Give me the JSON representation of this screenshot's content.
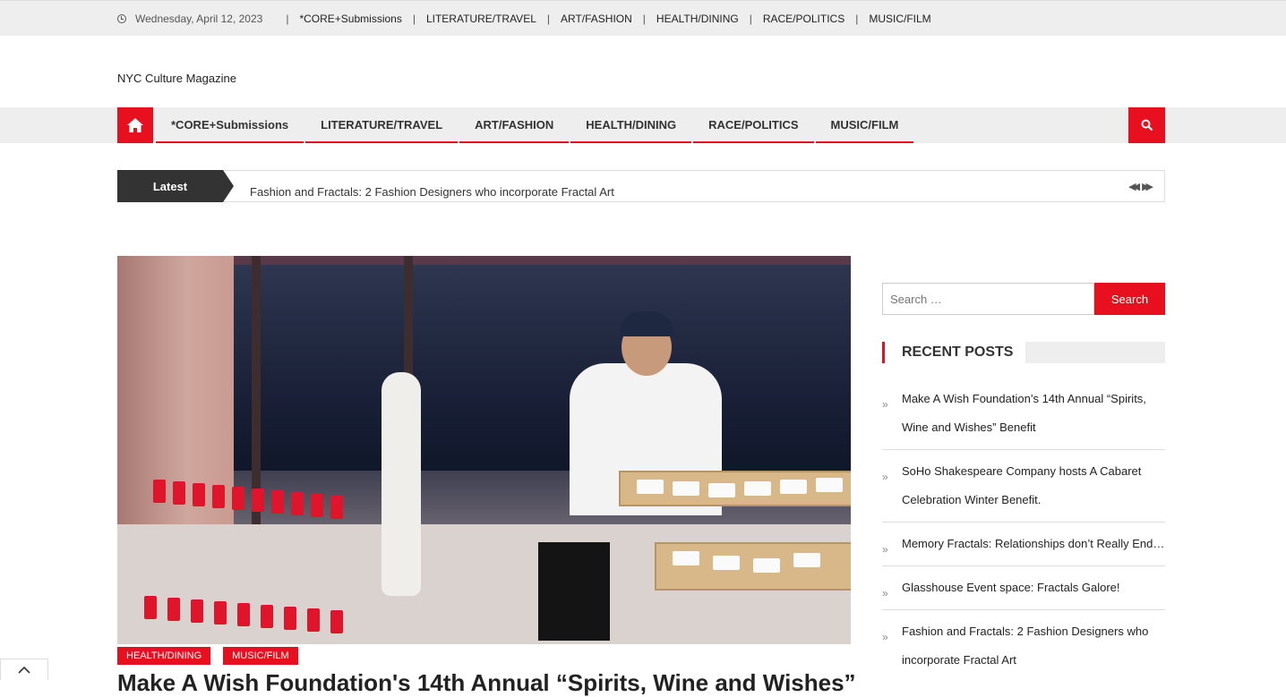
{
  "topbar": {
    "date": "Wednesday, April 12, 2023",
    "links": [
      "*CORE+Submissions",
      "LITERATURE/TRAVEL",
      "ART/FASHION",
      "HEALTH/DINING",
      "RACE/POLITICS",
      "MUSIC/FILM"
    ]
  },
  "site": {
    "title": "NYC Culture Magazine"
  },
  "nav": {
    "items": [
      "*CORE+Submissions",
      "LITERATURE/TRAVEL",
      "ART/FASHION",
      "HEALTH/DINING",
      "RACE/POLITICS",
      "MUSIC/FILM"
    ]
  },
  "ticker": {
    "label": "Latest",
    "headline": "Fashion and Fractals: 2 Fashion Designers who incorporate Fractal Art"
  },
  "featured": {
    "tags": [
      "HEALTH/DINING",
      "MUSIC/FILM"
    ],
    "title": "Make A Wish Foundation's 14th Annual “Spirits, Wine and Wishes”"
  },
  "sidebar": {
    "search_placeholder": "Search …",
    "search_button": "Search",
    "recent_title": "RECENT POSTS",
    "recent_posts": [
      "Make A Wish Foundation’s 14th Annual “Spirits, Wine and Wishes” Benefit",
      "SoHo Shakespeare Company hosts A Cabaret Celebration Winter Benefit.",
      "Memory Fractals: Relationships don’t Really End…",
      "Glasshouse Event space: Fractals Galore!",
      "Fashion and Fractals: 2 Fashion Designers who incorporate Fractal Art"
    ]
  },
  "colors": {
    "accent": "#e8101e",
    "dark": "#333333",
    "bar": "#eeeeee"
  },
  "icons": [
    "clock-icon",
    "home-icon",
    "search-icon",
    "chevron-left-icon",
    "chevron-right-icon",
    "chevron-up-icon"
  ]
}
